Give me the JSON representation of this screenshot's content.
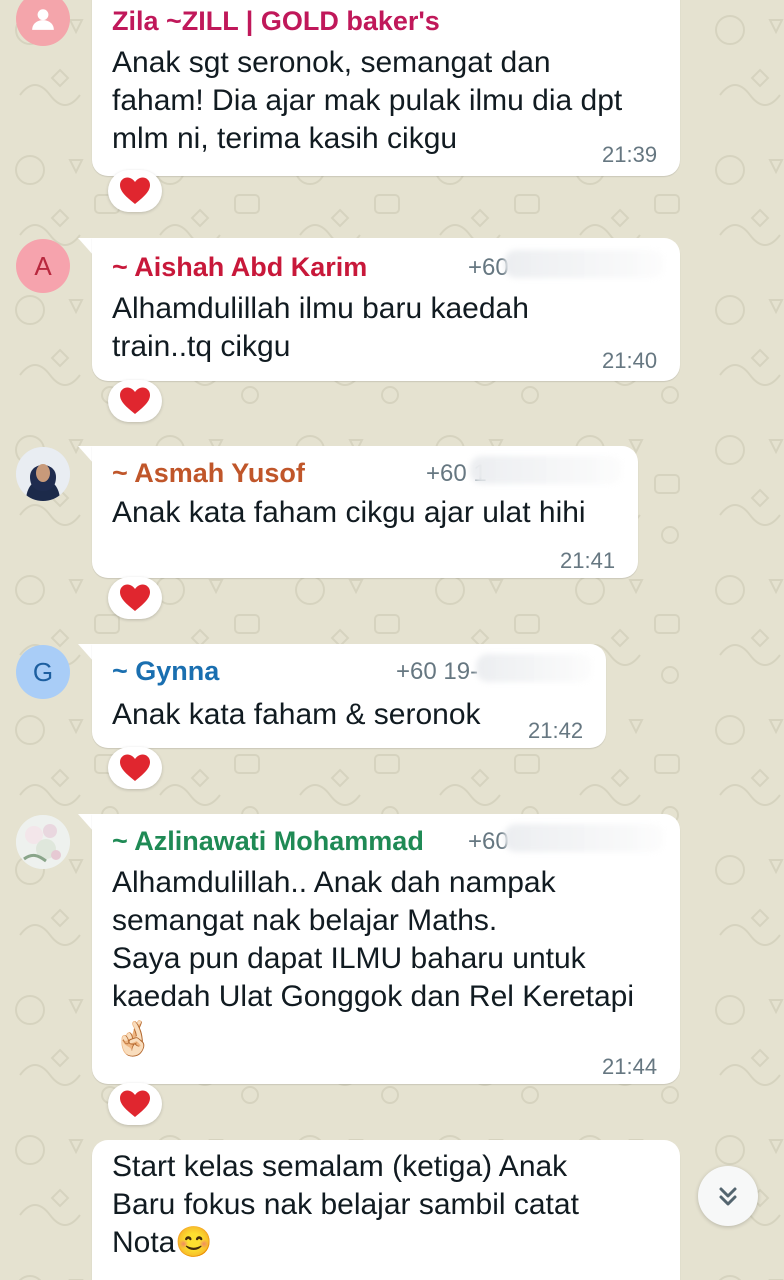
{
  "messages": [
    {
      "sender": "Zila ~ZILL | GOLD baker's",
      "sender_color": "#c0185a",
      "phone": "",
      "text": "Anak sgt seronok, semangat dan\nfaham! Dia ajar mak pulak ilmu dia dpt\nmlm ni, terima kasih cikgu",
      "time": "21:39",
      "reaction": "❤️",
      "avatar_icon": "default-person-icon"
    },
    {
      "sender": "~ Aishah Abd Karim",
      "sender_color": "#c8183a",
      "phone": "+60",
      "text": "Alhamdulillah ilmu baru kaedah\ntrain..tq cikgu",
      "time": "21:40",
      "reaction": "❤️",
      "avatar_letter": "A"
    },
    {
      "sender": "~ Asmah Yusof",
      "sender_color": "#c0562a",
      "phone": "+60 1",
      "text": "Anak kata faham cikgu ajar ulat hihi",
      "time": "21:41",
      "reaction": "❤️",
      "avatar_icon": "profile-photo"
    },
    {
      "sender": "~ Gynna",
      "sender_color": "#1a6fb0",
      "phone": "+60 19-",
      "text": "Anak kata faham & seronok",
      "time": "21:42",
      "reaction": "❤️",
      "avatar_letter": "G"
    },
    {
      "sender": "~ Azlinawati Mohammad",
      "sender_color": "#1f8a55",
      "phone": "+60",
      "text": "Alhamdulillah.. Anak dah nampak\nsemangat nak belajar Maths.\nSaya pun dapat ILMU baharu untuk\nkaedah Ulat Gonggok dan Rel Keretapi",
      "emoji": "🤞🏻",
      "time": "21:44",
      "reaction": "❤️",
      "avatar_icon": "profile-photo"
    },
    {
      "text": "Start kelas semalam (ketiga) Anak\nBaru fokus nak belajar sambil catat\nNota😊"
    }
  ],
  "scroll_button_icon": "double-chevron-down-icon",
  "colors": {
    "wallpaper": "#e5e2d0",
    "bubble": "#ffffff",
    "heart": "#e0262f"
  }
}
